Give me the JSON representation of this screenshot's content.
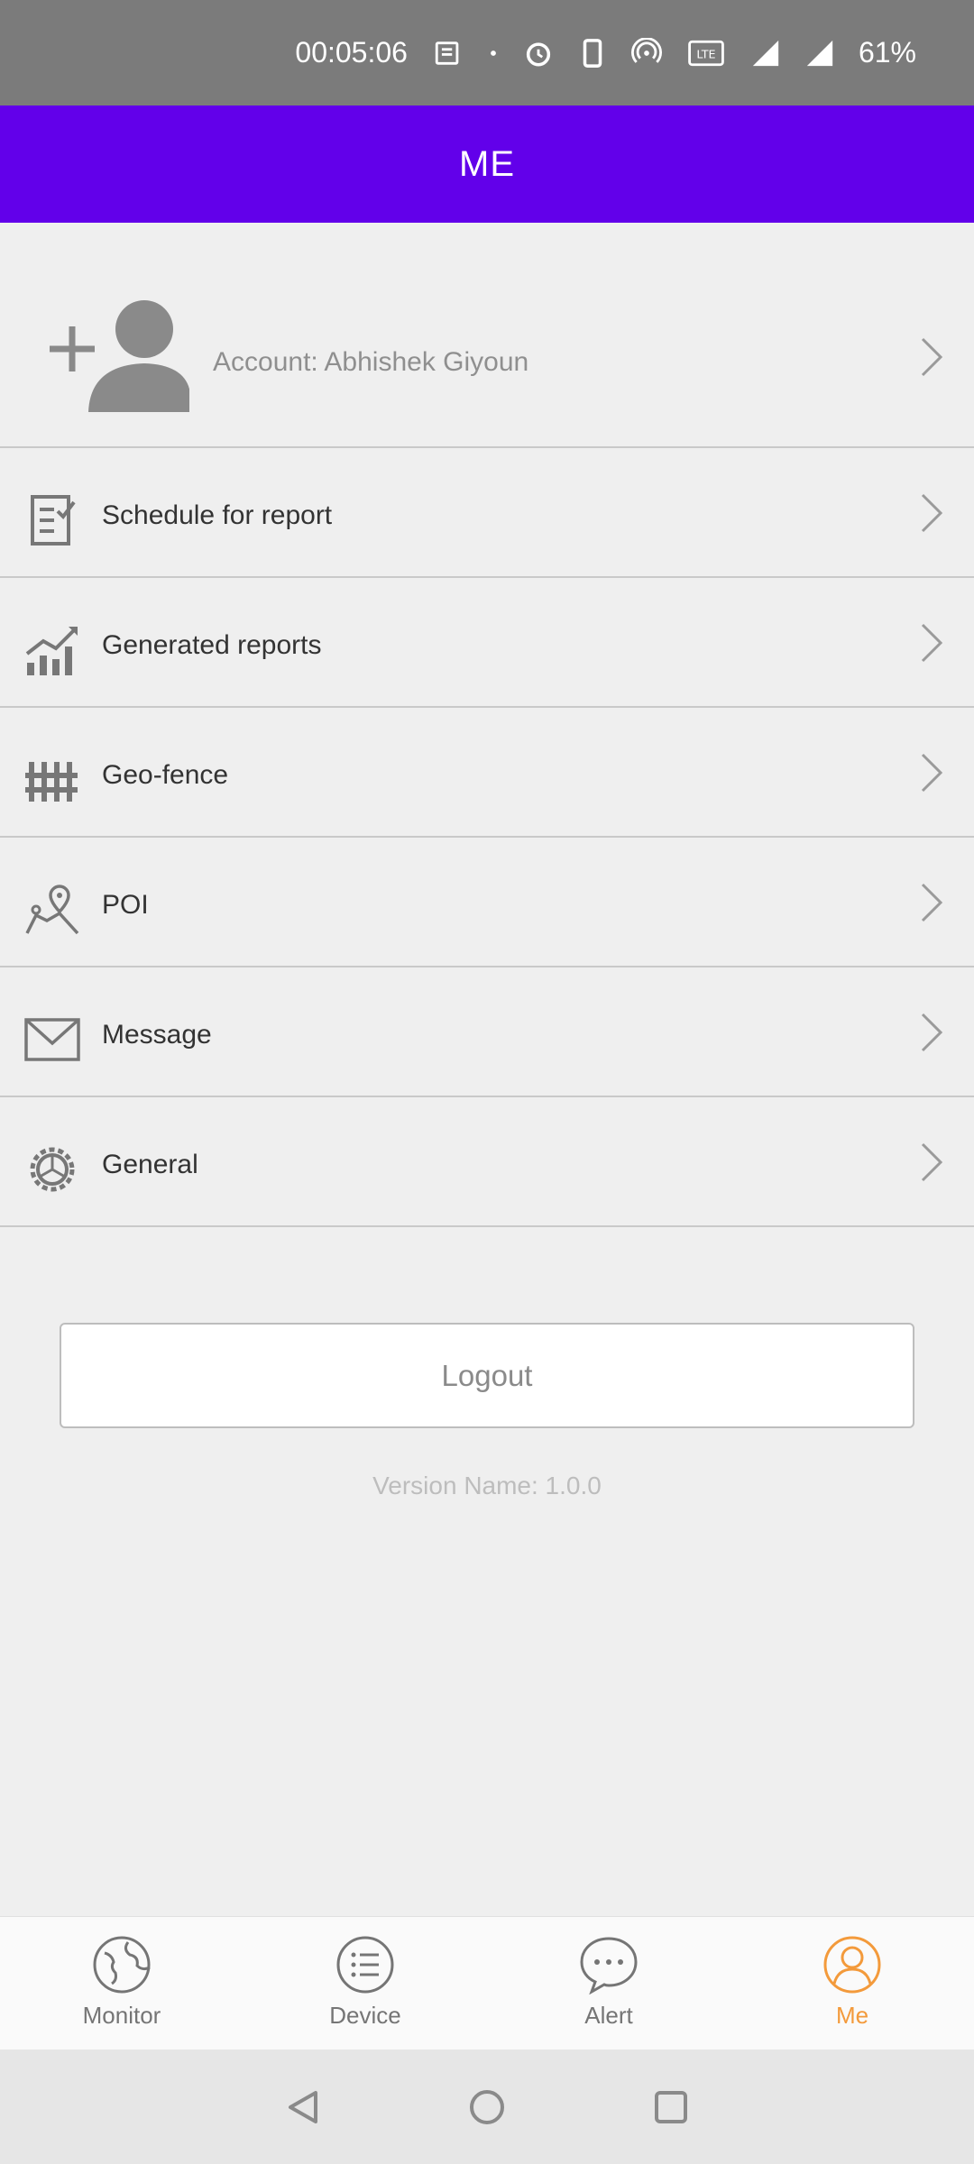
{
  "status_bar": {
    "time": "00:05:06",
    "battery": "61%",
    "icons": [
      "news-icon",
      "dot-icon",
      "alarm-icon",
      "phone-icon",
      "hotspot-icon",
      "volte-icon",
      "signal-4g-icon",
      "signal-r-icon"
    ]
  },
  "header": {
    "title": "ME"
  },
  "account": {
    "label": "Account: Abhishek Giyoun"
  },
  "menu": [
    {
      "label": "Schedule for report",
      "icon": "schedule-report-icon"
    },
    {
      "label": "Generated reports",
      "icon": "chart-growth-icon"
    },
    {
      "label": "Geo-fence",
      "icon": "fence-icon"
    },
    {
      "label": "POI",
      "icon": "map-pin-icon"
    },
    {
      "label": "Message",
      "icon": "envelope-icon"
    },
    {
      "label": "General",
      "icon": "gear-icon"
    }
  ],
  "logout_label": "Logout",
  "version": "Version Name: 1.0.0",
  "bottom_nav": [
    {
      "label": "Monitor",
      "icon": "globe-icon",
      "active": false
    },
    {
      "label": "Device",
      "icon": "list-icon",
      "active": false
    },
    {
      "label": "Alert",
      "icon": "chat-icon",
      "active": false
    },
    {
      "label": "Me",
      "icon": "user-icon",
      "active": true
    }
  ],
  "colors": {
    "header_bg": "#6200ea",
    "active_tab": "#f39a3b",
    "inactive_tab": "#757575"
  }
}
